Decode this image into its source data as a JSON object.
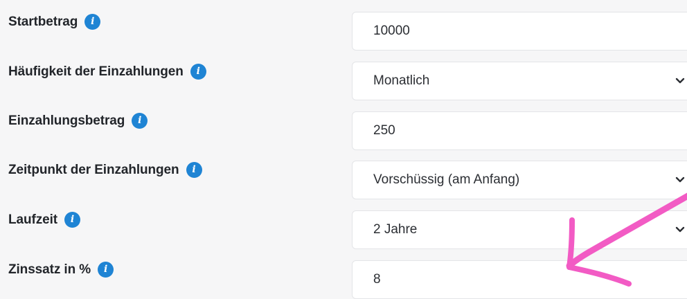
{
  "form": {
    "rows": [
      {
        "label": "Startbetrag",
        "value": "10000",
        "type": "input",
        "info_icon": "info-icon"
      },
      {
        "label": "Häufigkeit der Einzahlungen",
        "value": "Monatlich",
        "type": "select",
        "info_icon": "info-icon"
      },
      {
        "label": "Einzahlungsbetrag",
        "value": "250",
        "type": "input",
        "info_icon": "info-icon"
      },
      {
        "label": "Zeitpunkt der Einzahlungen",
        "value": "Vorschüssig (am Anfang)",
        "type": "select",
        "info_icon": "info-icon"
      },
      {
        "label": "Laufzeit",
        "value": "2 Jahre",
        "type": "select",
        "info_icon": "info-icon"
      },
      {
        "label": "Zinssatz in %",
        "value": "8",
        "type": "input",
        "info_icon": "info-icon"
      }
    ]
  },
  "colors": {
    "background": "#f6f6f7",
    "info_icon": "#1f84d4",
    "annotation_arrow": "#f25bc4"
  },
  "annotation": {
    "icon": "hand-drawn-arrow",
    "points_to": "Zinssatz in %"
  }
}
